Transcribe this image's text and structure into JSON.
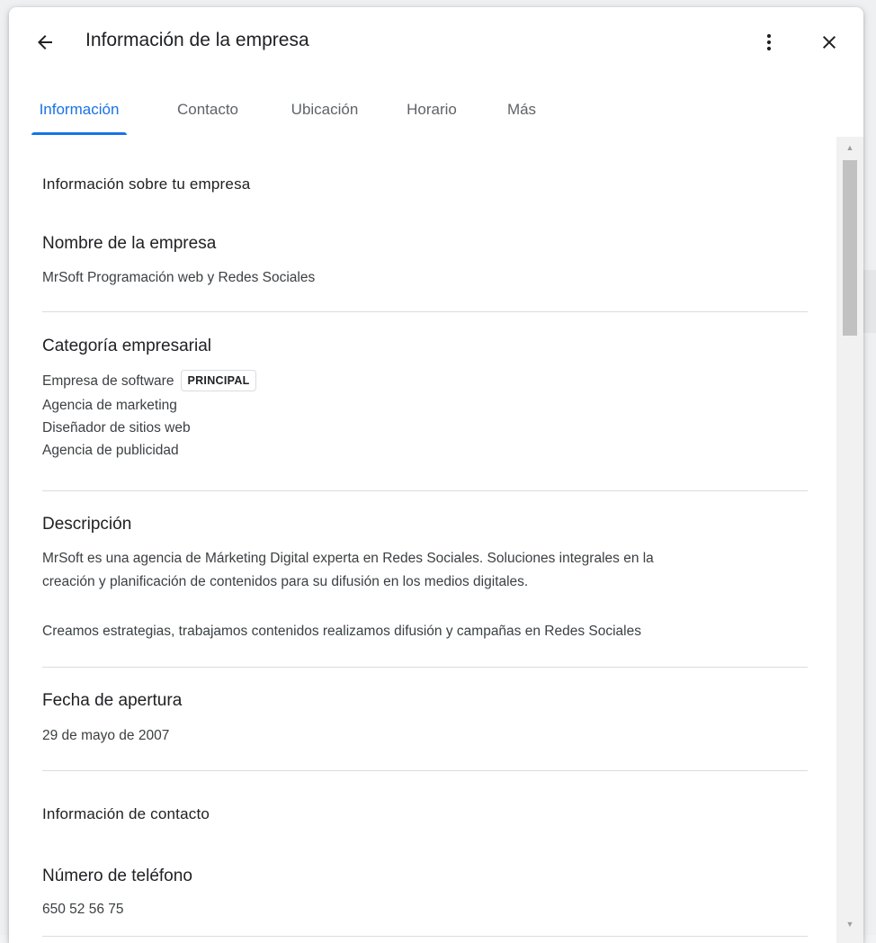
{
  "dialog": {
    "title": "Información de la empresa"
  },
  "icons": {
    "back": "arrow-back-icon",
    "more": "more-vert-icon",
    "close": "close-icon"
  },
  "tabs": [
    {
      "label": "Información",
      "active": true
    },
    {
      "label": "Contacto",
      "active": false
    },
    {
      "label": "Ubicación",
      "active": false
    },
    {
      "label": "Horario",
      "active": false
    },
    {
      "label": "Más",
      "active": false
    }
  ],
  "about_section": {
    "title": "Información sobre tu empresa",
    "business_name": {
      "label": "Nombre de la empresa",
      "value": "MrSoft Programación web y Redes Sociales"
    },
    "category": {
      "label": "Categoría empresarial",
      "primary": "Empresa de software",
      "primary_badge": "PRINCIPAL",
      "additional": [
        "Agencia de marketing",
        "Diseñador de sitios web",
        "Agencia de publicidad"
      ]
    },
    "description": {
      "label": "Descripción",
      "line1": "MrSoft es una agencia de Márketing Digital experta en Redes Sociales. Soluciones integrales en la",
      "line2": "creación y planificación de contenidos para su difusión en los medios digitales.",
      "line3": "Creamos estrategias, trabajamos contenidos realizamos difusión y campañas en Redes Sociales"
    },
    "opening_date": {
      "label": "Fecha de apertura",
      "value": "29 de mayo de 2007"
    }
  },
  "contact_section": {
    "title": "Información de contacto",
    "phone": {
      "label": "Número de teléfono",
      "value": "650 52 56 75"
    }
  },
  "colors": {
    "accent": "#1a73e8",
    "text_primary": "#202124",
    "text_secondary": "#5f6368",
    "divider": "#dadce0"
  }
}
